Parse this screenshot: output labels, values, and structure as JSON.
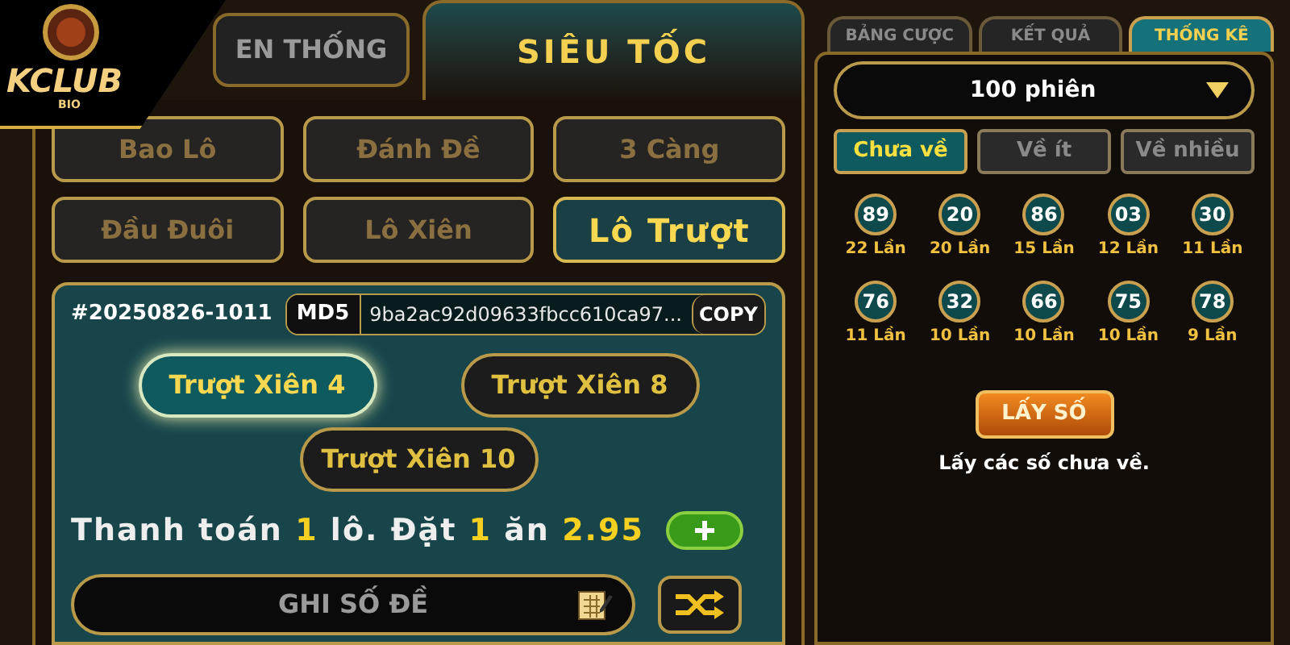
{
  "logo": {
    "name": "KCLUB",
    "sub": "BIO"
  },
  "mode_tabs": [
    {
      "label": "EN THỐNG",
      "selected": false
    },
    {
      "label": "SIÊU TỐC",
      "selected": true
    }
  ],
  "bet_types": [
    {
      "label": "Bao Lô",
      "selected": false
    },
    {
      "label": "Đánh Đề",
      "selected": false
    },
    {
      "label": "3 Càng",
      "selected": false
    },
    {
      "label": "Đầu Đuôi",
      "selected": false
    },
    {
      "label": "Lô Xiên",
      "selected": false
    },
    {
      "label": "Lô Trượt",
      "selected": true
    }
  ],
  "round": {
    "id": "#20250826-1011",
    "md5_label": "MD5",
    "md5": "9ba2ac92d09633fbcc610ca97...",
    "copy": "COPY"
  },
  "options": [
    {
      "label": "Trượt Xiên 4",
      "selected": true
    },
    {
      "label": "Trượt Xiên 8",
      "selected": false
    },
    {
      "label": "Trượt Xiên 10",
      "selected": false
    }
  ],
  "payout": "Thanh toán **1** lô. Đặt **1** ăn **2.95**",
  "number_input": {
    "placeholder": "GHI SỐ ĐỀ"
  },
  "side_tabs": [
    {
      "label": "BẢNG CƯỢC",
      "selected": false
    },
    {
      "label": "KẾT QUẢ",
      "selected": false
    },
    {
      "label": "THỐNG KÊ",
      "selected": true
    }
  ],
  "period_select": {
    "value": "100 phiên"
  },
  "filters": [
    {
      "label": "Chưa về",
      "selected": true
    },
    {
      "label": "Về ít",
      "selected": false
    },
    {
      "label": "Về nhiều",
      "selected": false
    }
  ],
  "numbers": [
    {
      "number": "89",
      "count": "22 Lần"
    },
    {
      "number": "20",
      "count": "20 Lần"
    },
    {
      "number": "86",
      "count": "15 Lần"
    },
    {
      "number": "03",
      "count": "12 Lần"
    },
    {
      "number": "30",
      "count": "11 Lần"
    },
    {
      "number": "76",
      "count": "11 Lần"
    },
    {
      "number": "32",
      "count": "10 Lần"
    },
    {
      "number": "66",
      "count": "10 Lần"
    },
    {
      "number": "75",
      "count": "10 Lần"
    },
    {
      "number": "78",
      "count": "9 Lần"
    }
  ],
  "pick_button": "LẤY SỐ",
  "pick_hint": "Lấy các số chưa về."
}
